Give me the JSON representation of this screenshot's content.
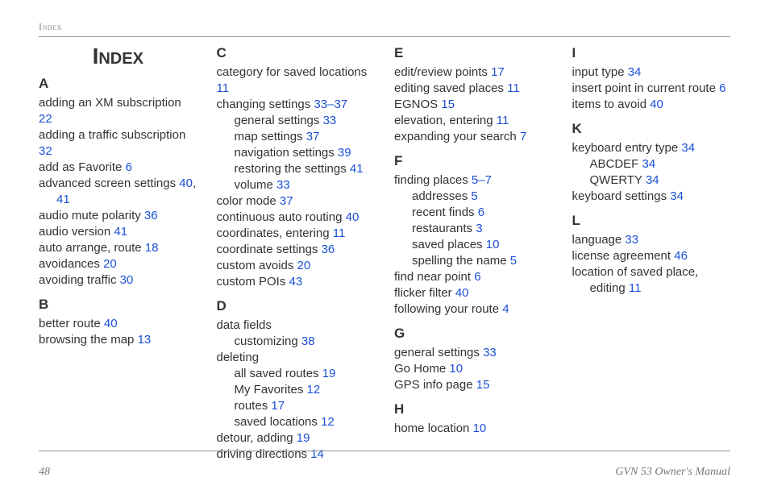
{
  "header": {
    "section_label": "Index"
  },
  "title": "Index",
  "footer": {
    "page_number": "48",
    "manual_title": "GVN 53 Owner's Manual"
  },
  "index": [
    {
      "letter": "A",
      "entries": [
        {
          "text": "adding an XM subscription",
          "pages": "22",
          "level": 0
        },
        {
          "text": "adding a traffic subscription",
          "pages": "32",
          "level": 0
        },
        {
          "text": "add as Favorite",
          "pages": "6",
          "level": 0
        },
        {
          "text": "advanced screen settings",
          "pages": "40, 41",
          "level": 0,
          "wrap_pages": true
        },
        {
          "text": "audio mute polarity",
          "pages": "36",
          "level": 0
        },
        {
          "text": "audio version",
          "pages": "41",
          "level": 0
        },
        {
          "text": "auto arrange, route",
          "pages": "18",
          "level": 0
        },
        {
          "text": "avoidances",
          "pages": "20",
          "level": 0
        },
        {
          "text": "avoiding traffic",
          "pages": "30",
          "level": 0
        }
      ]
    },
    {
      "letter": "B",
      "entries": [
        {
          "text": "better route",
          "pages": "40",
          "level": 0
        },
        {
          "text": "browsing the map",
          "pages": "13",
          "level": 0
        }
      ]
    },
    {
      "letter": "C",
      "entries": [
        {
          "text": "category for saved locations",
          "pages": "11",
          "level": 0
        },
        {
          "text": "changing settings",
          "pages": "33–37",
          "level": 0
        },
        {
          "text": "general settings",
          "pages": "33",
          "level": 1
        },
        {
          "text": "map settings",
          "pages": "37",
          "level": 1
        },
        {
          "text": "navigation settings",
          "pages": "39",
          "level": 1
        },
        {
          "text": "restoring the settings",
          "pages": "41",
          "level": 1
        },
        {
          "text": "volume",
          "pages": "33",
          "level": 1
        },
        {
          "text": "color mode",
          "pages": "37",
          "level": 0
        },
        {
          "text": "continuous auto routing",
          "pages": "40",
          "level": 0
        },
        {
          "text": "coordinates, entering",
          "pages": "11",
          "level": 0
        },
        {
          "text": "coordinate settings",
          "pages": "36",
          "level": 0
        },
        {
          "text": "custom avoids",
          "pages": "20",
          "level": 0
        },
        {
          "text": "custom POIs",
          "pages": "43",
          "level": 0
        }
      ]
    },
    {
      "letter": "D",
      "entries": [
        {
          "text": "data fields",
          "pages": "",
          "level": 0
        },
        {
          "text": "customizing",
          "pages": "38",
          "level": 1
        },
        {
          "text": "deleting",
          "pages": "",
          "level": 0
        },
        {
          "text": "all saved routes",
          "pages": "19",
          "level": 1
        },
        {
          "text": "My Favorites",
          "pages": "12",
          "level": 1
        },
        {
          "text": "routes",
          "pages": "17",
          "level": 1
        },
        {
          "text": "saved locations",
          "pages": "12",
          "level": 1
        },
        {
          "text": "detour, adding",
          "pages": "19",
          "level": 0
        },
        {
          "text": "driving directions",
          "pages": "14",
          "level": 0
        }
      ]
    },
    {
      "letter": "E",
      "entries": [
        {
          "text": "edit/review points",
          "pages": "17",
          "level": 0
        },
        {
          "text": "editing saved places",
          "pages": "11",
          "level": 0
        },
        {
          "text": "EGNOS",
          "pages": "15",
          "level": 0
        },
        {
          "text": "elevation, entering",
          "pages": "11",
          "level": 0
        },
        {
          "text": "expanding your search",
          "pages": "7",
          "level": 0
        }
      ]
    },
    {
      "letter": "F",
      "entries": [
        {
          "text": "finding places",
          "pages": "5–7",
          "level": 0
        },
        {
          "text": "addresses",
          "pages": "5",
          "level": 1
        },
        {
          "text": "recent finds",
          "pages": "6",
          "level": 1
        },
        {
          "text": "restaurants",
          "pages": "3",
          "level": 1
        },
        {
          "text": "saved places",
          "pages": "10",
          "level": 1
        },
        {
          "text": "spelling the name",
          "pages": "5",
          "level": 1
        },
        {
          "text": "find near point",
          "pages": "6",
          "level": 0
        },
        {
          "text": "flicker filter",
          "pages": "40",
          "level": 0
        },
        {
          "text": "following your route",
          "pages": "4",
          "level": 0
        }
      ]
    },
    {
      "letter": "G",
      "entries": [
        {
          "text": "general settings",
          "pages": "33",
          "level": 0
        },
        {
          "text": "Go Home",
          "pages": "10",
          "level": 0
        },
        {
          "text": "GPS info page",
          "pages": "15",
          "level": 0
        }
      ]
    },
    {
      "letter": "H",
      "entries": [
        {
          "text": "home location",
          "pages": "10",
          "level": 0
        }
      ]
    },
    {
      "letter": "I",
      "entries": [
        {
          "text": "input type",
          "pages": "34",
          "level": 0
        },
        {
          "text": "insert point in current route",
          "pages": "6",
          "level": 0
        },
        {
          "text": "items to avoid",
          "pages": "40",
          "level": 0
        }
      ]
    },
    {
      "letter": "K",
      "entries": [
        {
          "text": "keyboard entry type",
          "pages": "34",
          "level": 0
        },
        {
          "text": "ABCDEF",
          "pages": "34",
          "level": 1
        },
        {
          "text": "QWERTY",
          "pages": "34",
          "level": 1
        },
        {
          "text": "keyboard settings",
          "pages": "34",
          "level": 0
        }
      ]
    },
    {
      "letter": "L",
      "entries": [
        {
          "text": "language",
          "pages": "33",
          "level": 0
        },
        {
          "text": "license agreement",
          "pages": "46",
          "level": 0
        },
        {
          "text": "location of saved place, editing",
          "pages": "11",
          "level": 0,
          "wrap_text": true
        }
      ]
    }
  ]
}
